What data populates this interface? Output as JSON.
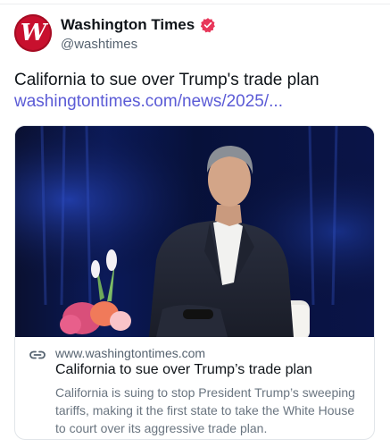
{
  "author": {
    "display_name": "Washington Times",
    "handle": "@washtimes",
    "avatar_letter": "W",
    "verified_icon": "verified-badge-icon",
    "brand_color": "#c8102e"
  },
  "post": {
    "text": "California to sue over Trump's trade plan",
    "link_text": "washingtontimes.com/news/2025/..."
  },
  "card": {
    "image_alt": "Man in dark suit seated on stage with flowers",
    "link_icon": "link-icon",
    "domain": "www.washingtontimes.com",
    "title": "California to sue over Trump’s trade plan",
    "description": "California is suing to stop President Trump’s sweeping tariffs, making it the first state to take the White House to court over its aggressive trade plan."
  },
  "colors": {
    "link": "#5b5bd6",
    "secondary_text": "#566370",
    "verified_badge": "#e8375a"
  }
}
